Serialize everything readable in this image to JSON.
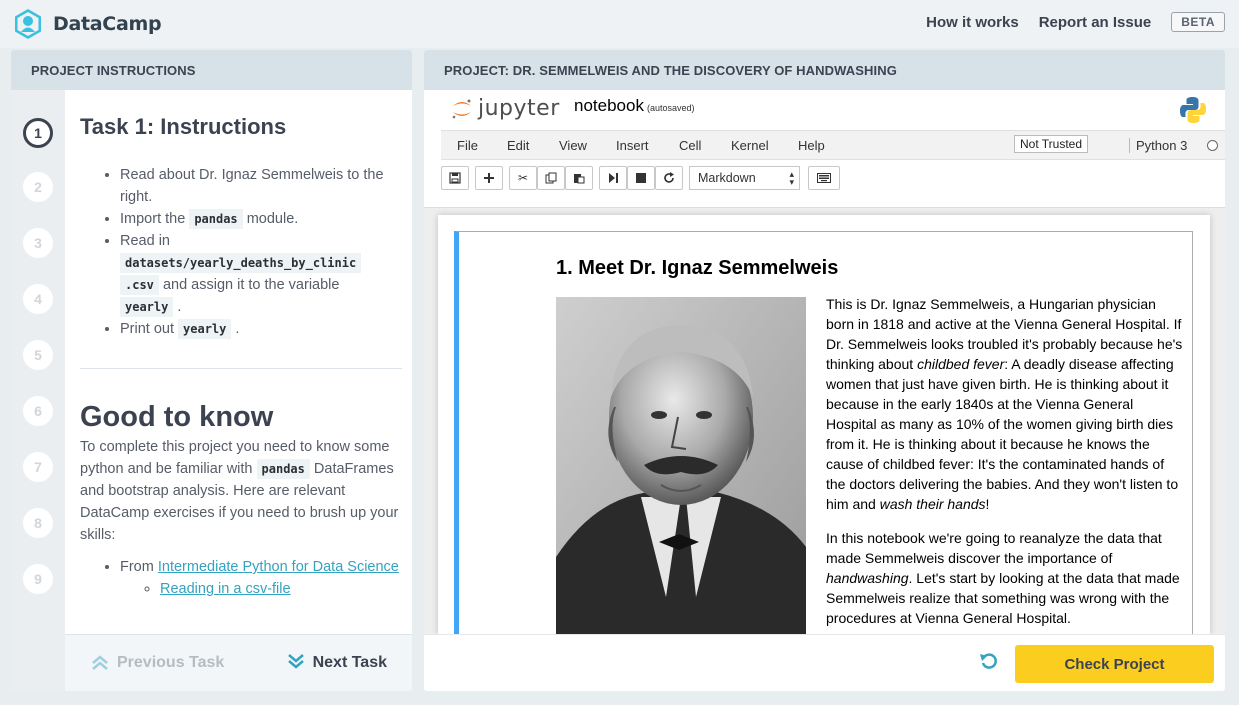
{
  "topbar": {
    "brand": "DataCamp",
    "links": [
      "How it works",
      "Report an Issue"
    ],
    "beta": "BETA"
  },
  "left": {
    "header": "PROJECT INSTRUCTIONS",
    "steps": [
      "1",
      "2",
      "3",
      "4",
      "5",
      "6",
      "7",
      "8",
      "9"
    ],
    "task_title": "Task 1: Instructions",
    "bullets": {
      "b1": "Read about Dr. Ignaz Semmelweis to the right.",
      "b2_pre": "Import the",
      "b2_code": "pandas",
      "b2_post": "module.",
      "b3_pre": "Read in",
      "b3_code1": "datasets/yearly_deaths_by_clinic",
      "b3_code2": ".csv",
      "b3_mid": "and assign it to the variable",
      "b3_code3": "yearly",
      "b3_post": ".",
      "b4_pre": "Print out",
      "b4_code": "yearly",
      "b4_post": "."
    },
    "good_title": "Good to know",
    "good_text_pre": "To complete this project you need to know some python and be familiar with",
    "good_text_code": "pandas",
    "good_text_post": "DataFrames and bootstrap analysis. Here are relevant DataCamp exercises if you need to brush up your skills:",
    "from_label": "From",
    "course_link": "Intermediate Python for Data Science",
    "sub_link": "Reading in a csv-file",
    "prev_task": "Previous Task",
    "next_task": "Next Task"
  },
  "right": {
    "header": "PROJECT: DR. SEMMELWEIS AND THE DISCOVERY OF HANDWASHING",
    "jupyter_label": "jupyter",
    "notebook_title": "notebook",
    "autosaved": "(autosaved)",
    "menu": [
      "File",
      "Edit",
      "View",
      "Insert",
      "Cell",
      "Kernel",
      "Help"
    ],
    "trust": "Not Trusted",
    "kernel": "Python 3",
    "cell_type": "Markdown",
    "cell_heading": "1. Meet Dr. Ignaz Semmelweis",
    "para1": {
      "a": "This is Dr. Ignaz Semmelweis, a Hungarian physician born in 1818 and active at the Vienna General Hospital. If Dr. Semmelweis looks troubled it's probably because he's thinking about ",
      "b": "childbed fever",
      "c": ": A deadly disease affecting women that just have given birth. He is thinking about it because in the early 1840s at the Vienna General Hospital as many as 10% of the women giving birth dies from it. He is thinking about it because he knows the cause of childbed fever: It's the contaminated hands of the doctors delivering the babies. And they won't listen to him and ",
      "d": "wash their hands",
      "e": "!"
    },
    "para2": {
      "a": "In this notebook we're going to reanalyze the data that made Semmelweis discover the importance of ",
      "b": "handwashing",
      "c": ". Let's start by looking at the data that made Semmelweis realize that something was wrong with the procedures at Vienna General Hospital."
    },
    "check_button": "Check Project"
  },
  "colors": {
    "accent_blue": "#33a3bf",
    "check_yellow": "#fbcd1f",
    "cell_border_blue": "#42a5f5",
    "panel_header": "#d6e2e8"
  }
}
